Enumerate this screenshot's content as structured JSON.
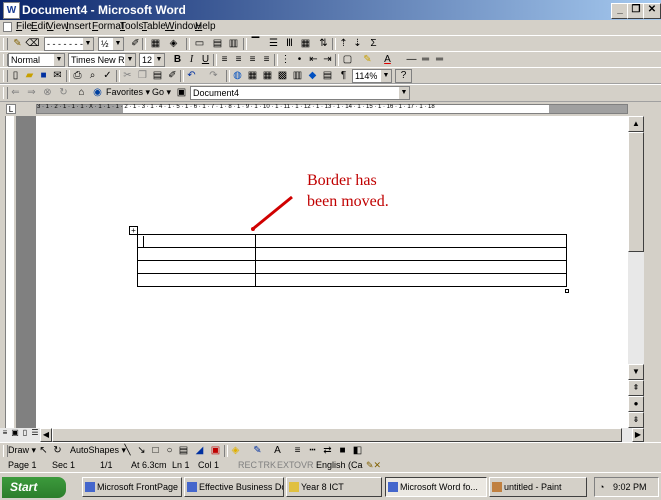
{
  "window": {
    "title": "Document4 - Microsoft Word",
    "app_icon": "W"
  },
  "window_buttons": {
    "minimize": "_",
    "restore": "❐",
    "close": "✕"
  },
  "menu": [
    "File",
    "Edit",
    "View",
    "Insert",
    "Format",
    "Tools",
    "Table",
    "Window",
    "Help"
  ],
  "tables_borders_toolbar": {
    "line_style": "- - - - - - - -",
    "line_weight": "½",
    "sum_symbol": "Σ"
  },
  "formatting_toolbar": {
    "style": "Normal",
    "font": "Times New Roman",
    "size": "12",
    "bold": "B",
    "italic": "I",
    "underline": "U",
    "font_color_letter": "A"
  },
  "standard_toolbar": {
    "zoom": "114%",
    "help": "?",
    "pilcrow": "¶"
  },
  "web_toolbar": {
    "favorites": "Favorites",
    "go": "Go",
    "address": "Document4"
  },
  "ruler": {
    "marks": "3 · 1 · 2 · 1 · 1 · 1 · X · 1 · 1 · 1 · 2 · 1 · 3 · 1 · 4 · 1 · 5 · 1 · 6 · 1 · 7 · 1 · 8 · 1 · 9 · 1 · 10 · 1 · 11 · 1 · 12 · 1 · 13 · 1 · 14 · 1 · 15 · 1 · 16 · 1 · 17 · 1 · 18"
  },
  "document": {
    "annotation_line1": "Border has",
    "annotation_line2": "been moved.",
    "annotation_color": "#c00000",
    "table_rows": 4,
    "table_cols": 2
  },
  "drawing_toolbar": {
    "draw": "Draw",
    "autoshapes": "AutoShapes"
  },
  "status": {
    "page": "Page 1",
    "section": "Sec 1",
    "pages": "1/1",
    "at": "At 6.3cm",
    "line": "Ln 1",
    "col": "Col 1",
    "rec": "REC",
    "trk": "TRK",
    "ext": "EXT",
    "ovr": "OVR",
    "language": "English (Ca"
  },
  "taskbar": {
    "start": "Start",
    "tasks": [
      {
        "label": "Microsoft FrontPage -...",
        "active": false
      },
      {
        "label": "Effective Business Do...",
        "active": false
      },
      {
        "label": "Year 8 ICT",
        "active": false
      },
      {
        "label": "Microsoft Word fo...",
        "active": true
      },
      {
        "label": "untitled - Paint",
        "active": false
      }
    ],
    "clock": "9:02 PM"
  }
}
